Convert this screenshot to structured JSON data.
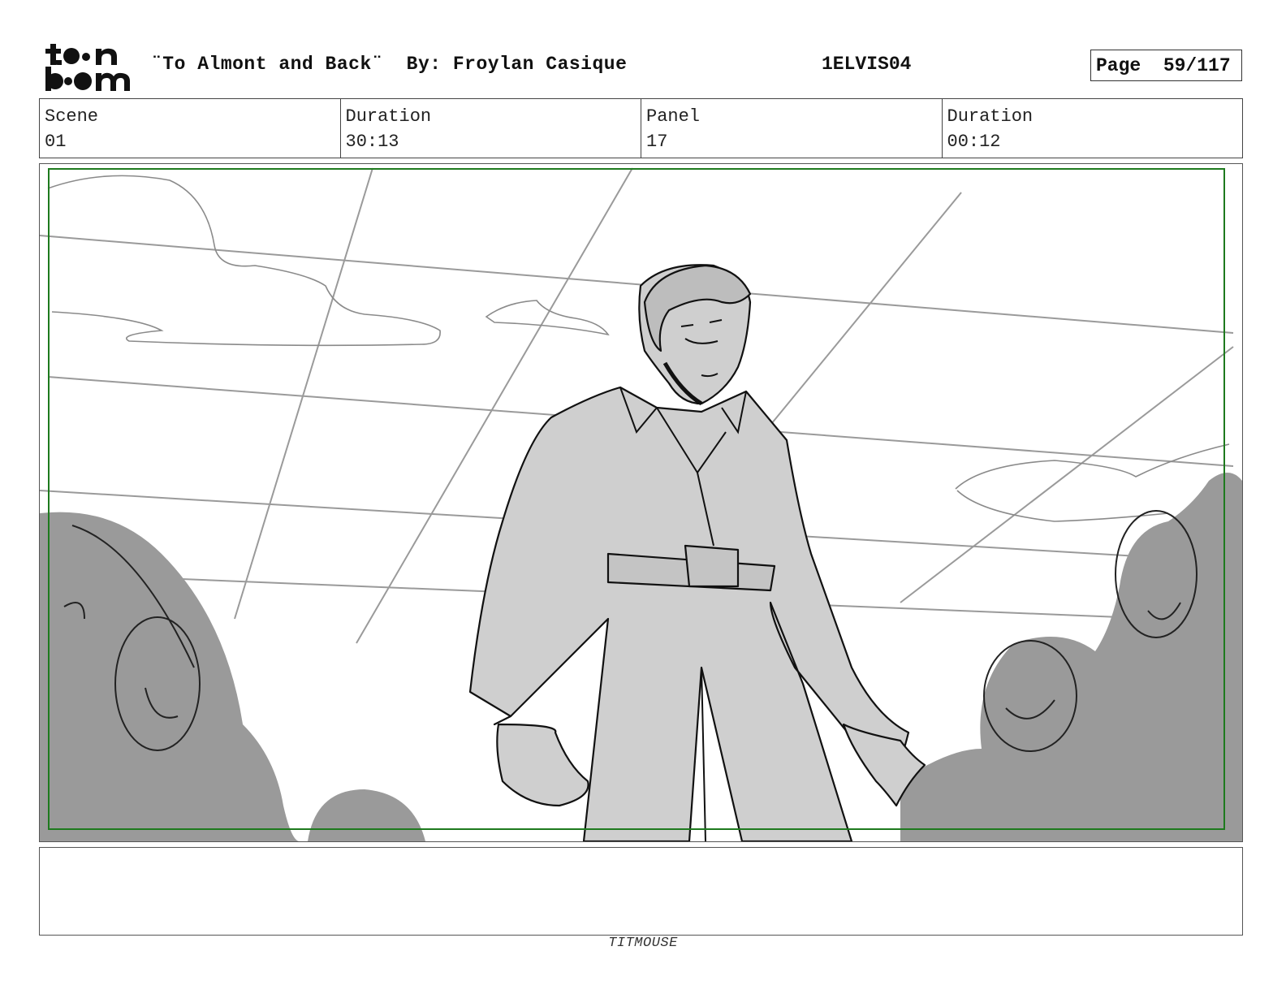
{
  "header": {
    "title": "¨To Almont and Back¨  By: Froylan Casique",
    "production_code": "1ELVIS04",
    "page": "Page  59/117"
  },
  "logo": {
    "text_top": "toon",
    "text_bottom": "boom",
    "icon": "toon-boom-logo"
  },
  "info": {
    "scene_label": "Scene",
    "scene_value": "01",
    "duration_label": "Duration",
    "duration_value": "30:13",
    "panel_label": "Panel",
    "panel_value": "17",
    "panel_duration_label": "Duration",
    "panel_duration_value": "00:12"
  },
  "panel": {
    "drawing": "storyboard-sketch",
    "safe_frame_color": "#1e7a1e"
  },
  "notes": {
    "text": ""
  },
  "footer": {
    "studio": "TITMOUSE"
  }
}
